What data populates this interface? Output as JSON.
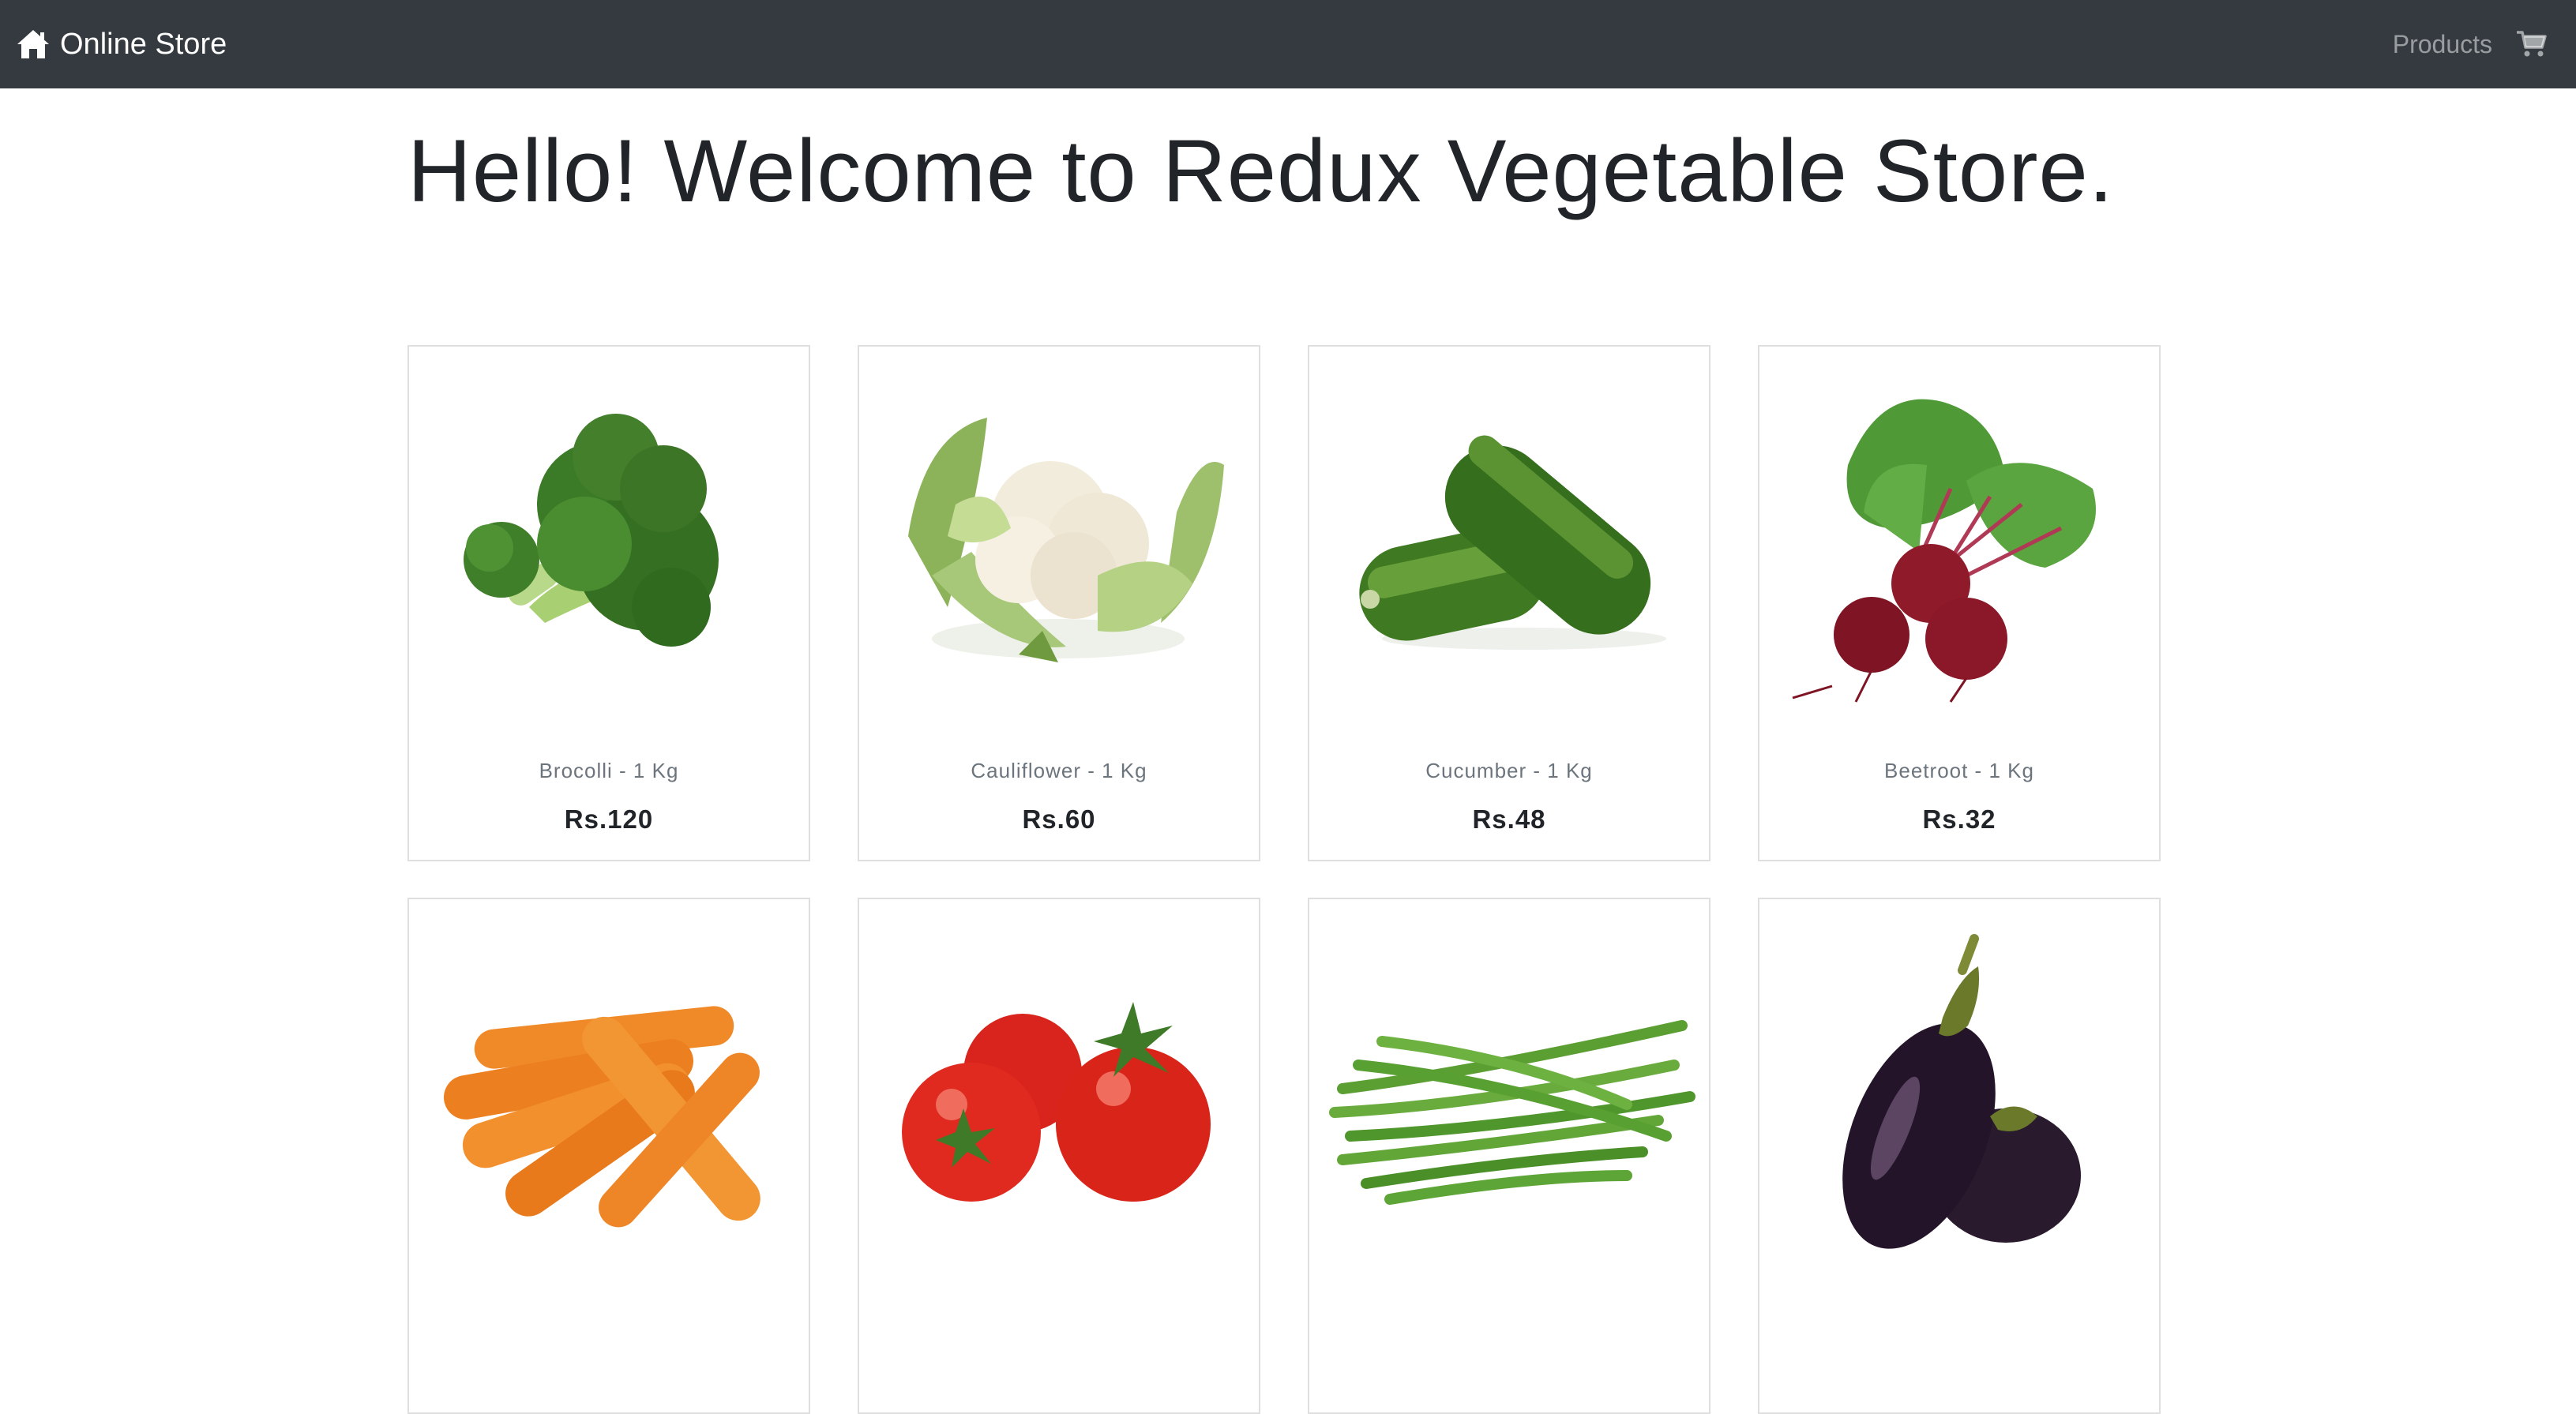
{
  "navbar": {
    "brand": "Online Store",
    "brand_icon": "home-icon",
    "products_link": "Products",
    "cart_icon": "cart-icon",
    "background": "#343a40"
  },
  "page": {
    "title": "Hello! Welcome to Redux Vegetable Store."
  },
  "products": [
    {
      "name": "Brocolli - 1 Kg",
      "price": "Rs.120",
      "image": "broccoli"
    },
    {
      "name": "Cauliflower - 1 Kg",
      "price": "Rs.60",
      "image": "cauliflower"
    },
    {
      "name": "Cucumber - 1 Kg",
      "price": "Rs.48",
      "image": "cucumber"
    },
    {
      "name": "Beetroot - 1 Kg",
      "price": "Rs.32",
      "image": "beetroot"
    },
    {
      "name": "",
      "price": "",
      "image": "carrots"
    },
    {
      "name": "",
      "price": "",
      "image": "tomatoes"
    },
    {
      "name": "",
      "price": "",
      "image": "green-beans"
    },
    {
      "name": "",
      "price": "",
      "image": "eggplant"
    }
  ]
}
